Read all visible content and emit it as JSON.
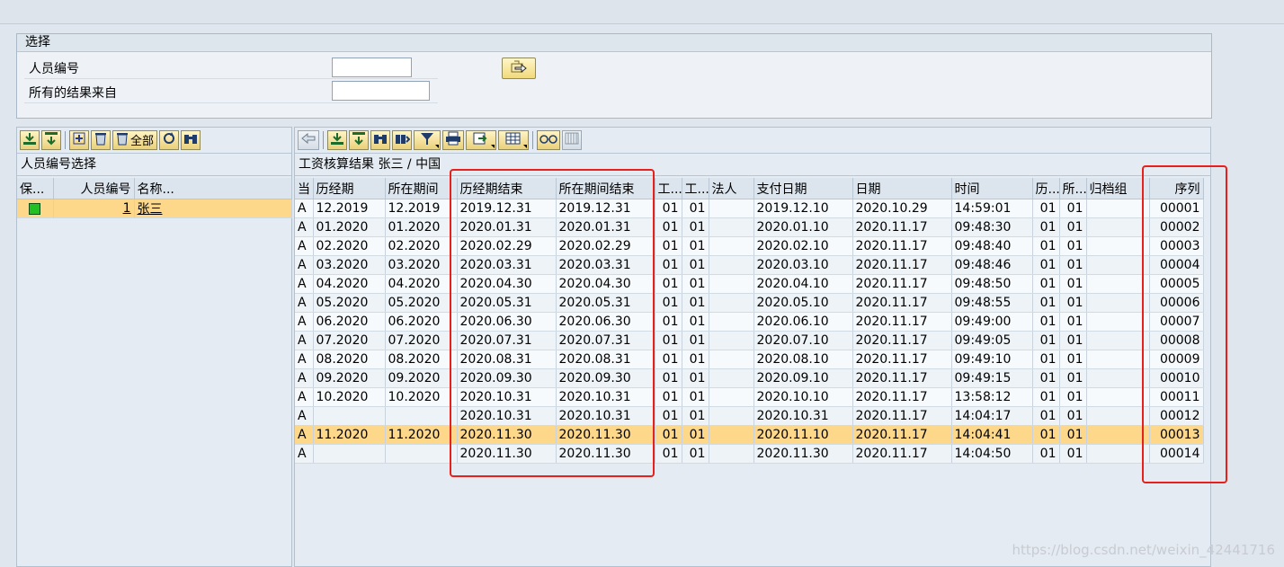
{
  "selection": {
    "title": "选择",
    "fields": [
      {
        "label": "人员编号",
        "value": ""
      },
      {
        "label": "所有的结果来自",
        "value": ""
      }
    ],
    "execute_icon": "execute-icon"
  },
  "left_panel": {
    "toolbar": [
      {
        "name": "sum-icon"
      },
      {
        "name": "subtotal-icon"
      },
      {
        "name": "insert-row-icon"
      },
      {
        "name": "delete-icon"
      },
      {
        "name": "delete-all-icon",
        "label": "全部"
      },
      {
        "name": "refresh-icon"
      },
      {
        "name": "find-icon"
      }
    ],
    "title": "人员编号选择",
    "columns": [
      "保...",
      "人员编号",
      "名称..."
    ],
    "rows": [
      {
        "status": "green",
        "id": "1",
        "name": "张三"
      }
    ]
  },
  "right_panel": {
    "toolbar": [
      {
        "name": "back-icon"
      },
      {
        "name": "sum-icon"
      },
      {
        "name": "subtotal-icon"
      },
      {
        "name": "find-icon"
      },
      {
        "name": "find-next-icon"
      },
      {
        "name": "filter-icon"
      },
      {
        "name": "print-icon"
      },
      {
        "name": "export-icon"
      },
      {
        "name": "layout-icon"
      },
      {
        "name": "glasses-icon"
      },
      {
        "name": "table-icon"
      }
    ],
    "title": "工资核算结果 张三 / 中国",
    "columns": [
      "当",
      "历经期",
      "所在期间",
      "历经期结束",
      "所在期间结束",
      "工...",
      "工...",
      "法人",
      "支付日期",
      "日期",
      "时间",
      "历...",
      "所...",
      "归档组",
      "序列"
    ],
    "rows": [
      [
        "A",
        "12.2019",
        "12.2019",
        "2019.12.31",
        "2019.12.31",
        "01",
        "01",
        "",
        "2019.12.10",
        "2020.10.29",
        "14:59:01",
        "01",
        "01",
        "",
        "00001"
      ],
      [
        "A",
        "01.2020",
        "01.2020",
        "2020.01.31",
        "2020.01.31",
        "01",
        "01",
        "",
        "2020.01.10",
        "2020.11.17",
        "09:48:30",
        "01",
        "01",
        "",
        "00002"
      ],
      [
        "A",
        "02.2020",
        "02.2020",
        "2020.02.29",
        "2020.02.29",
        "01",
        "01",
        "",
        "2020.02.10",
        "2020.11.17",
        "09:48:40",
        "01",
        "01",
        "",
        "00003"
      ],
      [
        "A",
        "03.2020",
        "03.2020",
        "2020.03.31",
        "2020.03.31",
        "01",
        "01",
        "",
        "2020.03.10",
        "2020.11.17",
        "09:48:46",
        "01",
        "01",
        "",
        "00004"
      ],
      [
        "A",
        "04.2020",
        "04.2020",
        "2020.04.30",
        "2020.04.30",
        "01",
        "01",
        "",
        "2020.04.10",
        "2020.11.17",
        "09:48:50",
        "01",
        "01",
        "",
        "00005"
      ],
      [
        "A",
        "05.2020",
        "05.2020",
        "2020.05.31",
        "2020.05.31",
        "01",
        "01",
        "",
        "2020.05.10",
        "2020.11.17",
        "09:48:55",
        "01",
        "01",
        "",
        "00006"
      ],
      [
        "A",
        "06.2020",
        "06.2020",
        "2020.06.30",
        "2020.06.30",
        "01",
        "01",
        "",
        "2020.06.10",
        "2020.11.17",
        "09:49:00",
        "01",
        "01",
        "",
        "00007"
      ],
      [
        "A",
        "07.2020",
        "07.2020",
        "2020.07.31",
        "2020.07.31",
        "01",
        "01",
        "",
        "2020.07.10",
        "2020.11.17",
        "09:49:05",
        "01",
        "01",
        "",
        "00008"
      ],
      [
        "A",
        "08.2020",
        "08.2020",
        "2020.08.31",
        "2020.08.31",
        "01",
        "01",
        "",
        "2020.08.10",
        "2020.11.17",
        "09:49:10",
        "01",
        "01",
        "",
        "00009"
      ],
      [
        "A",
        "09.2020",
        "09.2020",
        "2020.09.30",
        "2020.09.30",
        "01",
        "01",
        "",
        "2020.09.10",
        "2020.11.17",
        "09:49:15",
        "01",
        "01",
        "",
        "00010"
      ],
      [
        "A",
        "10.2020",
        "10.2020",
        "2020.10.31",
        "2020.10.31",
        "01",
        "01",
        "",
        "2020.10.10",
        "2020.11.17",
        "13:58:12",
        "01",
        "01",
        "",
        "00011"
      ],
      [
        "A",
        "",
        "",
        "2020.10.31",
        "2020.10.31",
        "01",
        "01",
        "",
        "2020.10.31",
        "2020.11.17",
        "14:04:17",
        "01",
        "01",
        "",
        "00012"
      ],
      [
        "A",
        "11.2020",
        "11.2020",
        "2020.11.30",
        "2020.11.30",
        "01",
        "01",
        "",
        "2020.11.10",
        "2020.11.17",
        "14:04:41",
        "01",
        "01",
        "",
        "00013"
      ],
      [
        "A",
        "",
        "",
        "2020.11.30",
        "2020.11.30",
        "01",
        "01",
        "",
        "2020.11.30",
        "2020.11.17",
        "14:04:50",
        "01",
        "01",
        "",
        "00014"
      ]
    ],
    "selected_row": 12
  },
  "watermark": "https://blog.csdn.net/weixin_42441716",
  "colors": {
    "selected_row": "#fdd88a",
    "highlight_box": "#e8201c",
    "status_ok": "#22c022"
  }
}
